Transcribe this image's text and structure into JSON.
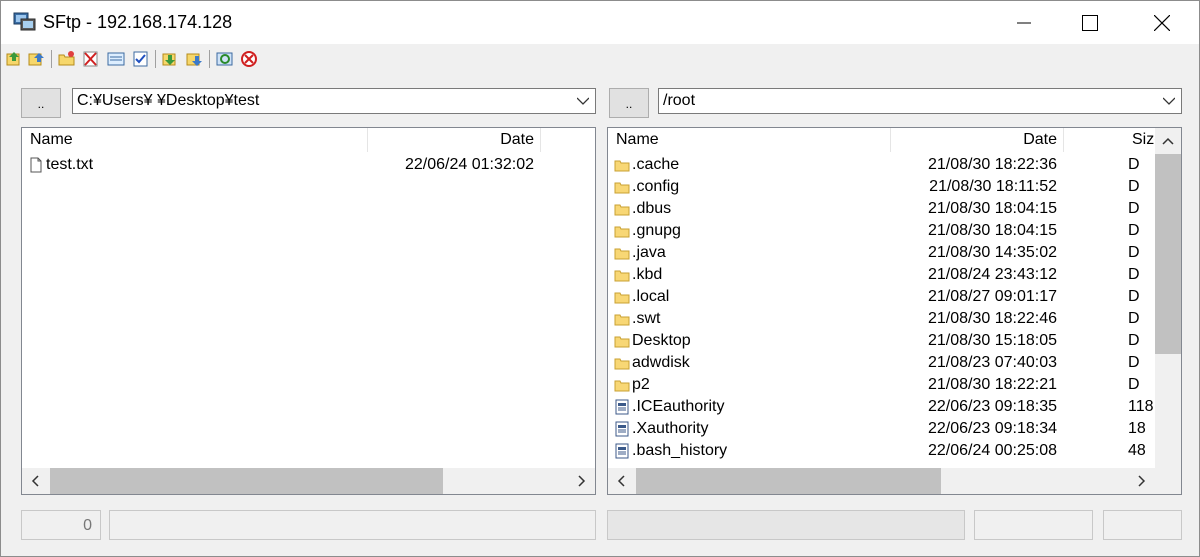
{
  "window": {
    "title": "SFtp - 192.168.174.128"
  },
  "toolbar": {
    "buttons": [
      "upload-icon",
      "upload-all-icon",
      "new-folder-icon",
      "delete-icon",
      "view-icon",
      "check-icon",
      "download-icon",
      "download-all-icon",
      "refresh-icon",
      "disconnect-icon"
    ]
  },
  "left": {
    "up_label": "..",
    "path": "C:¥Users¥            ¥Desktop¥test",
    "columns": {
      "name": "Name",
      "date": "Date"
    },
    "files": [
      {
        "name": "test.txt",
        "date": "22/06/24 01:32:02",
        "icon": "file-icon"
      }
    ]
  },
  "right": {
    "up_label": "..",
    "path": "/root",
    "columns": {
      "name": "Name",
      "date": "Date",
      "size": "Size"
    },
    "files": [
      {
        "name": ".cache",
        "date": "21/08/30 18:22:36",
        "size": "D",
        "icon": "folder-icon"
      },
      {
        "name": ".config",
        "date": "21/08/30 18:11:52",
        "size": "D",
        "icon": "folder-icon"
      },
      {
        "name": ".dbus",
        "date": "21/08/30 18:04:15",
        "size": "D",
        "icon": "folder-icon"
      },
      {
        "name": ".gnupg",
        "date": "21/08/30 18:04:15",
        "size": "D",
        "icon": "folder-icon"
      },
      {
        "name": ".java",
        "date": "21/08/30 14:35:02",
        "size": "D",
        "icon": "folder-icon"
      },
      {
        "name": ".kbd",
        "date": "21/08/24 23:43:12",
        "size": "D",
        "icon": "folder-icon"
      },
      {
        "name": ".local",
        "date": "21/08/27 09:01:17",
        "size": "D",
        "icon": "folder-icon"
      },
      {
        "name": ".swt",
        "date": "21/08/30 18:22:46",
        "size": "D",
        "icon": "folder-icon"
      },
      {
        "name": "Desktop",
        "date": "21/08/30 15:18:05",
        "size": "D",
        "icon": "folder-icon"
      },
      {
        "name": "adwdisk",
        "date": "21/08/23 07:40:03",
        "size": "D",
        "icon": "folder-icon"
      },
      {
        "name": "p2",
        "date": "21/08/30 18:22:21",
        "size": "D",
        "icon": "folder-icon"
      },
      {
        "name": ".ICEauthority",
        "date": "22/06/23 09:18:35",
        "size": "118",
        "icon": "doc-icon"
      },
      {
        "name": ".Xauthority",
        "date": "22/06/23 09:18:34",
        "size": "18",
        "icon": "doc-icon"
      },
      {
        "name": ".bash_history",
        "date": "22/06/24 00:25:08",
        "size": "48",
        "icon": "doc-icon"
      }
    ]
  },
  "status": {
    "left_count": "0"
  }
}
